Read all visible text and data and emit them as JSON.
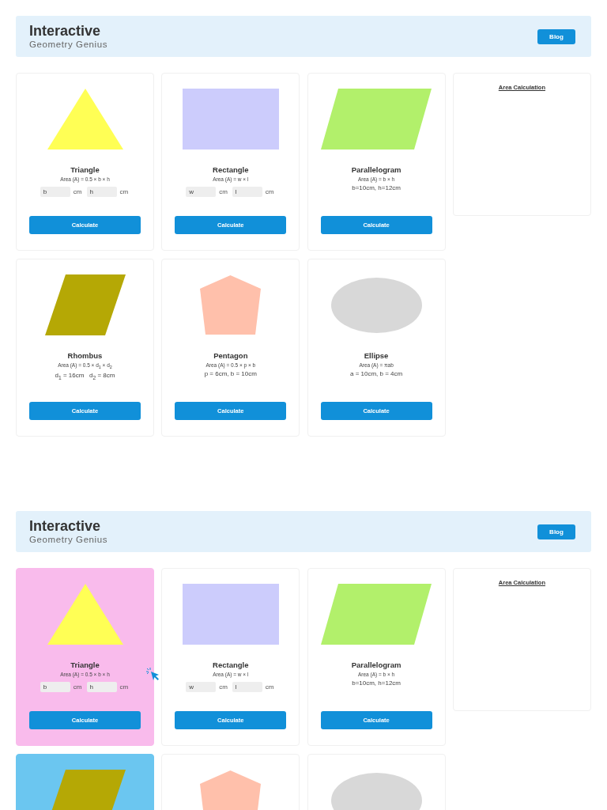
{
  "frames": [
    {
      "header": {
        "title": "Interactive",
        "subtitle": "Geometry Genius",
        "button": "Blog"
      },
      "pointer_visible": false,
      "cards": [
        {
          "shape": {
            "kind": "triangle",
            "color": "#ffff55"
          },
          "name": "Triangle",
          "formula": "Area (A) = 0.5 × b × h",
          "fields": [
            {
              "placeholder": "b",
              "unit": "cm"
            },
            {
              "placeholder": "h",
              "unit": "cm"
            }
          ],
          "button": "Calculate"
        },
        {
          "shape": {
            "kind": "rectangle",
            "color": "#ccccfc"
          },
          "name": "Rectangle",
          "formula": "Area (A) = w × l",
          "fields": [
            {
              "placeholder": "w",
              "unit": "cm"
            },
            {
              "placeholder": "l",
              "unit": "cm"
            }
          ],
          "button": "Calculate"
        },
        {
          "shape": {
            "kind": "parallelogram",
            "color": "#b2f06b"
          },
          "name": "Parallelogram",
          "formula": "Area (A) = b × h",
          "given": "b=10cm, h=12cm",
          "button": "Calculate"
        },
        {
          "shape": {
            "kind": "rhombus",
            "color": "#b5a805"
          },
          "name": "Rhombus",
          "formula": "Area (A) = 0.5 × d$_{1}$ × d$_{2}$",
          "given": "d$_{1}$ = 16cm   d$_{2}$ = 8cm",
          "button": "Calculate"
        },
        {
          "shape": {
            "kind": "pentagon",
            "color": "#ffc0ab"
          },
          "name": "Pentagon",
          "formula": "Area (A) = 0.5 × p × b",
          "given": "p = 6cm, b = 10cm",
          "button": "Calculate"
        },
        {
          "shape": {
            "kind": "ellipse",
            "color": "#d8d8d8"
          },
          "name": "Ellipse",
          "formula": "Area (A) = πab",
          "given": "a = 10cm, b = 4cm",
          "button": "Calculate"
        }
      ],
      "panel": {
        "title": "Area Calculation"
      }
    },
    {
      "header": {
        "title": "Interactive",
        "subtitle": "Geometry Genius",
        "button": "Blog"
      },
      "pointer_visible": true,
      "cards": [
        {
          "color": "#f9bbec",
          "shape": {
            "kind": "triangle",
            "color": "#ffff55"
          },
          "name": "Triangle",
          "formula": "Area (A) = 0.5 × b × h",
          "fields": [
            {
              "placeholder": "b",
              "unit": "cm"
            },
            {
              "placeholder": "h",
              "unit": "cm"
            }
          ],
          "button": "Calculate"
        },
        {
          "shape": {
            "kind": "rectangle",
            "color": "#ccccfc"
          },
          "name": "Rectangle",
          "formula": "Area (A) = w × l",
          "fields": [
            {
              "placeholder": "w",
              "unit": "cm"
            },
            {
              "placeholder": "l",
              "unit": "cm"
            }
          ],
          "button": "Calculate"
        },
        {
          "shape": {
            "kind": "parallelogram",
            "color": "#b2f06b"
          },
          "name": "Parallelogram",
          "formula": "Area (A) = b × h",
          "given": "b=10cm, h=12cm",
          "button": "Calculate"
        },
        {
          "color": "#6bc6f0",
          "shape": {
            "kind": "rhombus",
            "color": "#b5a805"
          }
        },
        {
          "shape": {
            "kind": "pentagon",
            "color": "#ffc0ab"
          }
        },
        {
          "shape": {
            "kind": "ellipse",
            "color": "#d8d8d8"
          }
        }
      ],
      "panel": {
        "title": "Area Calculation"
      }
    }
  ]
}
